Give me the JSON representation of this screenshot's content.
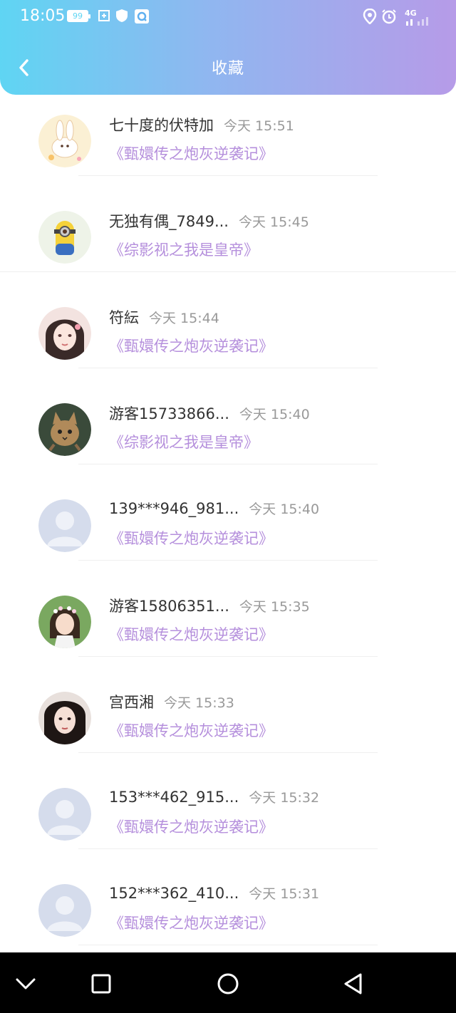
{
  "status_bar": {
    "time": "18:05",
    "battery": "99",
    "network": "4G",
    "icons": [
      "battery-icon",
      "notification-icon",
      "shield-icon",
      "qq-browser-icon",
      "location-icon",
      "alarm-icon",
      "signal-icon",
      "wifi-icon"
    ]
  },
  "header": {
    "title": "收藏",
    "back_icon": "chevron-left-icon",
    "gradient": [
      "#5fd5f3",
      "#b69be8"
    ]
  },
  "colors": {
    "work_title": "#b58fdc",
    "name": "#333333",
    "time": "#999999"
  },
  "favorites": [
    {
      "name": "七十度的伏特加",
      "time": "今天 15:51",
      "work": "《甄嬛传之炮灰逆袭记》",
      "avatar": "rabbit-avatar"
    },
    {
      "name": "无独有偶_7849...",
      "time": "今天 15:45",
      "work": "《综影视之我是皇帝》",
      "avatar": "minion-avatar"
    },
    {
      "name": "符紜",
      "time": "今天 15:44",
      "work": "《甄嬛传之炮灰逆袭记》",
      "avatar": "girl-illustration-avatar"
    },
    {
      "name": "游客15733866...",
      "time": "今天 15:40",
      "work": "《综影视之我是皇帝》",
      "avatar": "cat-avatar"
    },
    {
      "name": "139***946_981...",
      "time": "今天 15:40",
      "work": "《甄嬛传之炮灰逆袭记》",
      "avatar": "default-user-avatar"
    },
    {
      "name": "游客15806351...",
      "time": "今天 15:35",
      "work": "《甄嬛传之炮灰逆袭记》",
      "avatar": "child-photo-avatar"
    },
    {
      "name": "宫西湘",
      "time": "今天 15:33",
      "work": "《甄嬛传之炮灰逆袭记》",
      "avatar": "girl-photo-avatar"
    },
    {
      "name": "153***462_915...",
      "time": "今天 15:32",
      "work": "《甄嬛传之炮灰逆袭记》",
      "avatar": "default-user-avatar"
    },
    {
      "name": "152***362_410...",
      "time": "今天 15:31",
      "work": "《甄嬛传之炮灰逆袭记》",
      "avatar": "default-user-avatar"
    }
  ],
  "nav_bar": {
    "buttons": [
      "chevron-down-icon",
      "square-icon",
      "circle-icon",
      "triangle-back-icon"
    ]
  }
}
